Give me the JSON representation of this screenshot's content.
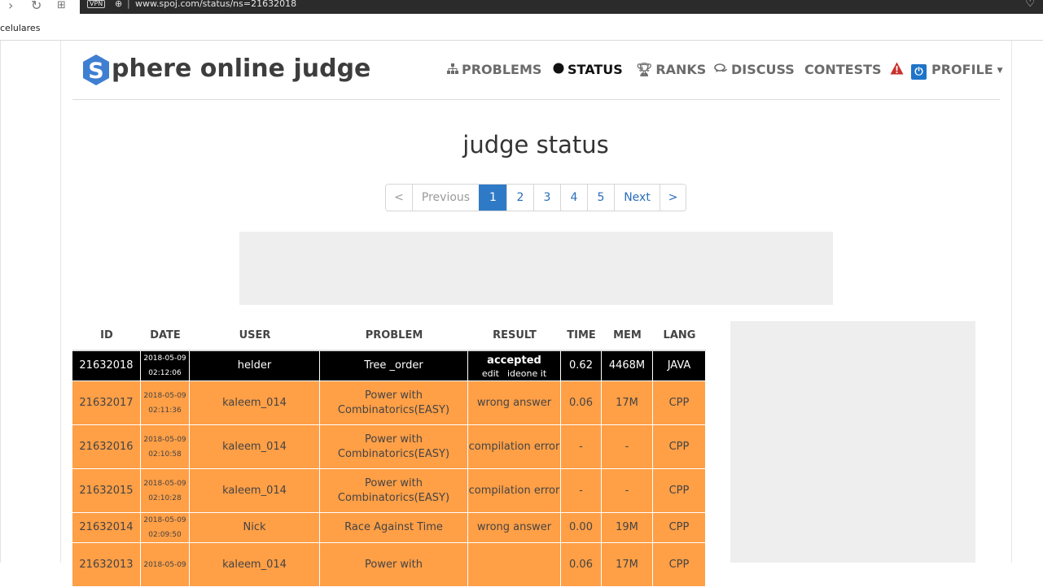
{
  "browser": {
    "vpn_label": "VPN",
    "url": "www.spoj.com/status/ns=21632018",
    "bookmark": "celulares"
  },
  "brand": {
    "name": "phere online judge",
    "logo_letter": "S"
  },
  "nav": [
    {
      "label": "PROBLEMS",
      "icon": "sitemap-icon"
    },
    {
      "label": "STATUS",
      "icon": "circle-icon"
    },
    {
      "label": "RANKS",
      "icon": "trophy-icon"
    },
    {
      "label": "DISCUSS",
      "icon": "comments-icon"
    },
    {
      "label": "CONTESTS",
      "icon": ""
    },
    {
      "label": "PROFILE",
      "icon": "power-icon"
    }
  ],
  "page": {
    "title": "judge status"
  },
  "pagination": {
    "first": "<",
    "previous": "Previous",
    "pages": [
      "1",
      "2",
      "3",
      "4",
      "5"
    ],
    "current": "1",
    "next": "Next",
    "last": ">"
  },
  "table": {
    "headers": [
      "ID",
      "DATE",
      "USER",
      "PROBLEM",
      "RESULT",
      "TIME",
      "MEM",
      "LANG"
    ],
    "rows": [
      {
        "id": "21632018",
        "date": "2018-05-09",
        "time_of_day": "02:12:06",
        "user": "helder",
        "problem": "Tree _order",
        "result": "accepted",
        "actions": [
          "edit",
          "ideone it"
        ],
        "time": "0.62",
        "mem": "4468M",
        "lang": "JAVA"
      },
      {
        "id": "21632017",
        "date": "2018-05-09",
        "time_of_day": "02:11:36",
        "user": "kaleem_014",
        "problem": "Power with Combinatorics(EASY)",
        "result": "wrong answer",
        "time": "0.06",
        "mem": "17M",
        "lang": "CPP"
      },
      {
        "id": "21632016",
        "date": "2018-05-09",
        "time_of_day": "02:10:58",
        "user": "kaleem_014",
        "problem": "Power with Combinatorics(EASY)",
        "result": "compilation error",
        "time": "-",
        "mem": "-",
        "lang": "CPP"
      },
      {
        "id": "21632015",
        "date": "2018-05-09",
        "time_of_day": "02:10:28",
        "user": "kaleem_014",
        "problem": "Power with Combinatorics(EASY)",
        "result": "compilation error",
        "time": "-",
        "mem": "-",
        "lang": "CPP"
      },
      {
        "id": "21632014",
        "date": "2018-05-09",
        "time_of_day": "02:09:50",
        "user": "Nick",
        "problem": "Race Against Time",
        "result": "wrong answer",
        "time": "0.00",
        "mem": "19M",
        "lang": "CPP"
      },
      {
        "id": "21632013",
        "date": "2018-05-09",
        "time_of_day": "",
        "user": "kaleem_014",
        "problem": "Power with",
        "result": "",
        "time": "0.06",
        "mem": "17M",
        "lang": "CPP"
      }
    ]
  },
  "colors": {
    "accepted_row": "#000000",
    "error_row": "#ff9f46",
    "active_page": "#2f7ac7",
    "brand_blue": "#3f7fd1"
  }
}
